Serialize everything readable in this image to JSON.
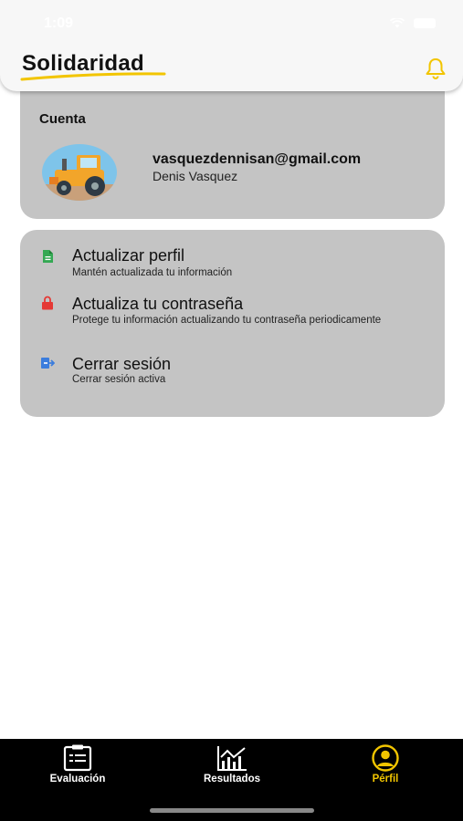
{
  "status_bar": {
    "time": "1:09"
  },
  "header": {
    "brand": "Solidaridad",
    "brand_accent_color": "#f2c500",
    "notification_icon": "bell-icon"
  },
  "account": {
    "title": "Cuenta",
    "email": "vasquezdennisan@gmail.com",
    "name": "Denis Vasquez",
    "avatar_icon": "tractor-avatar-icon"
  },
  "options": [
    {
      "icon": "document-icon",
      "icon_color": "#34a853",
      "title": "Actualizar perfil",
      "subtitle": "Mantén actualizada tu información"
    },
    {
      "icon": "lock-icon",
      "icon_color": "#e53935",
      "title": "Actualiza tu contraseña",
      "subtitle": "Protege tu información actualizando tu contraseña periodicamente"
    },
    {
      "icon": "logout-icon",
      "icon_color": "#3b7ddd",
      "title": "Cerrar sesión",
      "subtitle": "Cerrar sesión activa"
    }
  ],
  "tabs": [
    {
      "icon": "clipboard-icon",
      "label": "Evaluación",
      "active": false
    },
    {
      "icon": "chart-icon",
      "label": "Resultados",
      "active": false
    },
    {
      "icon": "profile-icon",
      "label": "Pérfil",
      "active": true
    }
  ],
  "colors": {
    "card_bg": "#c4c4c4",
    "tab_bar_bg": "#000000",
    "active_tab": "#f2c500"
  }
}
